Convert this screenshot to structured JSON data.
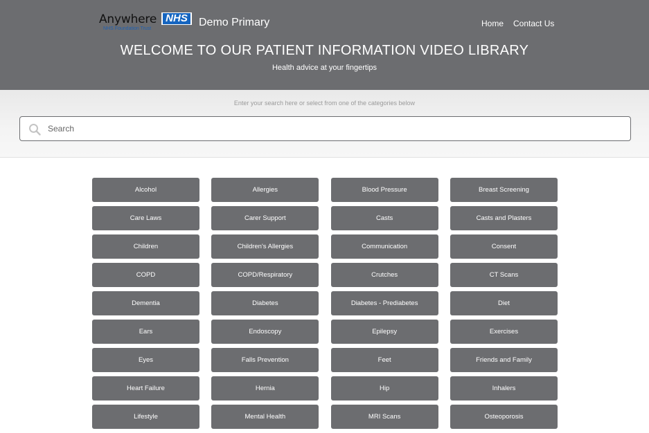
{
  "header": {
    "logo": {
      "word": "Anywhere",
      "badge": "NHS",
      "subtitle": "NHS Foundation Trust"
    },
    "brand_name": "Demo Primary",
    "nav": {
      "home": "Home",
      "contact": "Contact Us"
    },
    "title": "WELCOME TO OUR PATIENT INFORMATION VIDEO LIBRARY",
    "tagline": "Health advice at your fingertips"
  },
  "search": {
    "hint": "Enter your search here or select from one of the categories below",
    "placeholder": "Search",
    "value": ""
  },
  "categories": [
    "Alcohol",
    "Allergies",
    "Blood Pressure",
    "Breast Screening",
    "Care Laws",
    "Carer Support",
    "Casts",
    "Casts and Plasters",
    "Children",
    "Children's Allergies",
    "Communication",
    "Consent",
    "COPD",
    "COPD/Respiratory",
    "Crutches",
    "CT Scans",
    "Dementia",
    "Diabetes",
    "Diabetes - Prediabetes",
    "Diet",
    "Ears",
    "Endoscopy",
    "Epilepsy",
    "Exercises",
    "Eyes",
    "Falls Prevention",
    "Feet",
    "Friends and Family",
    "Heart Failure",
    "Hernia",
    "Hip",
    "Inhalers",
    "Lifestyle",
    "Mental Health",
    "MRI Scans",
    "Osteoporosis"
  ],
  "colors": {
    "header_bg": "#6c6d70",
    "button_bg": "#6c6d70",
    "nhs_blue": "#1565c0"
  },
  "icons": {
    "search": "search-icon"
  }
}
